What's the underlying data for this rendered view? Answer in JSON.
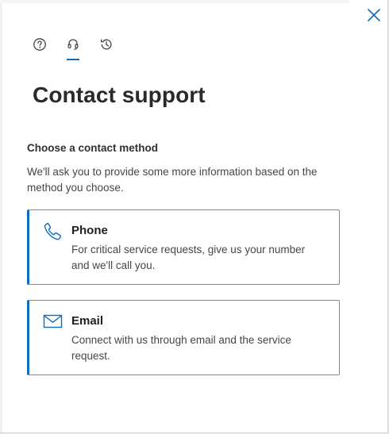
{
  "panel": {
    "title": "Contact support",
    "close_icon": "close-icon",
    "accent_color": "#0f6cbd"
  },
  "tabs": [
    {
      "icon": "help-circle-icon",
      "selected": false
    },
    {
      "icon": "headset-icon",
      "selected": true
    },
    {
      "icon": "history-icon",
      "selected": false
    }
  ],
  "section": {
    "label": "Choose a contact method",
    "description": "We'll ask you to provide some more information based on the method you choose."
  },
  "options": [
    {
      "icon": "phone-icon",
      "title": "Phone",
      "description": "For critical service requests, give us your number and we'll call you."
    },
    {
      "icon": "mail-icon",
      "title": "Email",
      "description": "Connect with us through email and the service request."
    }
  ]
}
